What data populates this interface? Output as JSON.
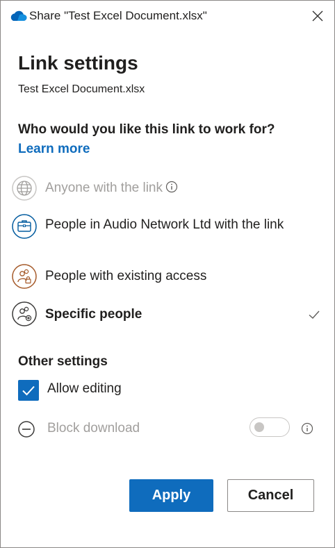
{
  "window": {
    "title": "Share \"Test Excel Document.xlsx\"",
    "close_icon": "close-icon"
  },
  "heading": "Link settings",
  "filename": "Test Excel Document.xlsx",
  "question": "Who would you like this link to work for?",
  "learn_more": "Learn more",
  "options": [
    {
      "label": "Anyone with the link",
      "icon": "globe-icon",
      "disabled": true,
      "selected": false
    },
    {
      "label": "People in Audio Network Ltd with the link",
      "icon": "briefcase-icon",
      "disabled": false,
      "selected": false
    },
    {
      "label": "People with existing access",
      "icon": "people-lock-icon",
      "disabled": false,
      "selected": false
    },
    {
      "label": "Specific people",
      "icon": "people-add-icon",
      "disabled": false,
      "selected": true
    }
  ],
  "other_settings": {
    "title": "Other settings",
    "allow_editing": {
      "label": "Allow editing",
      "checked": true
    },
    "block_download": {
      "label": "Block download",
      "enabled": false,
      "disabled": true
    }
  },
  "buttons": {
    "apply": "Apply",
    "cancel": "Cancel"
  },
  "colors": {
    "accent": "#0f6cbd",
    "disabled_text": "#a19f9d",
    "org_icon": "#005a9e",
    "existing_icon": "#a55a2a"
  }
}
